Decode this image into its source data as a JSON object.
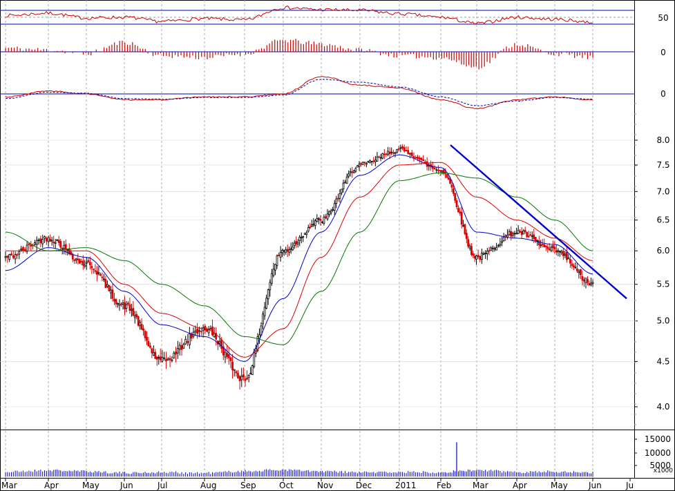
{
  "colors": {
    "background": "#ffffff",
    "frame": "#000000",
    "grid": "#9a9a9a",
    "up_candle": "#000000",
    "down_candle": "#dd0000",
    "ma_fast": "#0000cc",
    "ma_mid": "#dd0000",
    "ma_slow": "#007700",
    "trendline": "#0000cc",
    "oscillator": "#cc0000",
    "reference_line": "#0000aa",
    "volume": "#0000cc"
  },
  "chart_data": [
    {
      "type": "line",
      "panel": "oscillator",
      "ylim": [
        0,
        100
      ],
      "y_ticks": [
        "50"
      ],
      "reference_levels": [
        70,
        30
      ],
      "series": [
        {
          "x": [
            "Mar",
            "Apr",
            "May",
            "Jun",
            "Jul",
            "Aug",
            "Sep",
            "Oct",
            "Nov",
            "Dec",
            "2011",
            "Feb",
            "Mar",
            "Apr",
            "May",
            "Jun"
          ],
          "values": [
            55,
            62,
            48,
            50,
            38,
            46,
            42,
            78,
            72,
            70,
            60,
            50,
            32,
            50,
            44,
            36
          ]
        }
      ]
    },
    {
      "type": "bar",
      "panel": "histogram",
      "y_ticks": [
        "0"
      ],
      "x": [
        "Mar",
        "Apr",
        "May",
        "Jun",
        "Jul",
        "Aug",
        "Sep",
        "Oct",
        "Nov",
        "Dec",
        "2011",
        "Feb",
        "Mar",
        "Apr",
        "May",
        "Jun"
      ],
      "values": [
        0.2,
        0.1,
        -0.1,
        0.5,
        -0.2,
        -0.3,
        -0.1,
        0.6,
        0.4,
        0.1,
        -0.2,
        -0.3,
        -0.8,
        0.4,
        -0.1,
        -0.3
      ]
    },
    {
      "type": "line",
      "panel": "momentum",
      "y_ticks": [
        "0"
      ],
      "x": [
        "Mar",
        "Apr",
        "May",
        "Jun",
        "Jul",
        "Aug",
        "Sep",
        "Oct",
        "Nov",
        "Dec",
        "2011",
        "Feb",
        "Mar",
        "Apr",
        "May",
        "Jun"
      ],
      "series": [
        {
          "values": [
            -0.05,
            0.05,
            0.0,
            -0.1,
            -0.1,
            -0.05,
            -0.05,
            0.0,
            0.3,
            0.15,
            0.1,
            -0.1,
            -0.25,
            -0.1,
            -0.05,
            -0.1
          ]
        },
        {
          "values": [
            -0.08,
            0.03,
            0.01,
            -0.08,
            -0.09,
            -0.06,
            -0.06,
            -0.02,
            0.25,
            0.2,
            0.12,
            -0.05,
            -0.2,
            -0.12,
            -0.06,
            -0.09
          ]
        }
      ]
    },
    {
      "type": "candlestick",
      "panel": "price",
      "y_scale": "log",
      "ylim": [
        3.8,
        8.3
      ],
      "y_ticks": [
        "4.0",
        "4.5",
        "5.0",
        "5.5",
        "6.0",
        "6.5",
        "7.0",
        "7.5",
        "8.0"
      ],
      "x_ticks": [
        "Mar",
        "Apr",
        "May",
        "Jun",
        "Jul",
        "Aug",
        "Sep",
        "Oct",
        "Nov",
        "Dec",
        "2011",
        "Feb",
        "Mar",
        "Apr",
        "May",
        "Jun",
        "Ju"
      ],
      "x": [
        "Mar",
        "Apr",
        "May",
        "Jun",
        "Jul",
        "Aug",
        "Sep",
        "Oct",
        "Nov",
        "Dec",
        "2011",
        "Feb",
        "Mar",
        "Apr",
        "May",
        "Jun"
      ],
      "close": [
        5.9,
        6.2,
        5.8,
        5.2,
        4.5,
        4.9,
        4.3,
        6.0,
        6.5,
        7.5,
        7.8,
        7.4,
        5.9,
        6.3,
        6.0,
        5.5
      ],
      "moving_averages": [
        {
          "values": [
            5.7,
            6.05,
            5.9,
            5.4,
            4.95,
            4.8,
            4.5,
            5.3,
            6.3,
            7.3,
            7.7,
            7.45,
            6.3,
            6.2,
            6.1,
            5.65
          ]
        },
        {
          "values": [
            6.0,
            6.0,
            6.0,
            5.5,
            5.1,
            4.9,
            4.55,
            4.9,
            5.9,
            6.9,
            7.5,
            7.55,
            6.9,
            6.5,
            6.2,
            5.85
          ]
        },
        {
          "values": [
            6.3,
            6.0,
            6.05,
            5.85,
            5.5,
            5.2,
            4.8,
            4.7,
            5.4,
            6.3,
            7.2,
            7.35,
            7.25,
            6.9,
            6.5,
            6.0
          ]
        }
      ],
      "trendline": {
        "start": [
          "Feb",
          7.9
        ],
        "end": [
          "Jul",
          5.3
        ]
      }
    },
    {
      "type": "bar",
      "panel": "volume",
      "y_ticks": [
        "15000",
        "10000",
        "5000"
      ],
      "y_multiplier": "x1000",
      "x": [
        "Mar",
        "Apr",
        "May",
        "Jun",
        "Jul",
        "Aug",
        "Sep",
        "Oct",
        "Nov",
        "Dec",
        "2011",
        "Feb",
        "Mar",
        "Apr",
        "May",
        "Jun"
      ],
      "values": [
        2200,
        3000,
        2500,
        1800,
        2000,
        1700,
        2600,
        3200,
        2400,
        2000,
        2100,
        16500,
        3000,
        2200,
        2400,
        1900
      ]
    }
  ]
}
